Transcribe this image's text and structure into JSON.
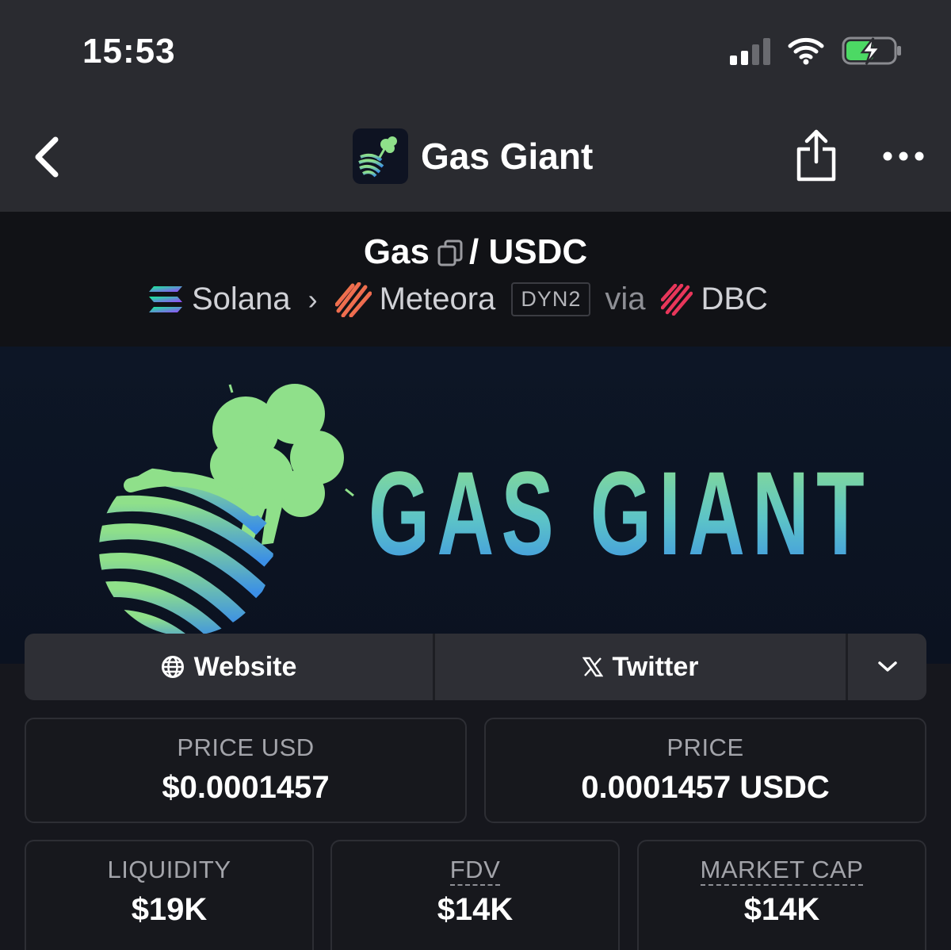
{
  "status_bar": {
    "time": "15:53",
    "signal_icon": "cellular-signal-icon",
    "wifi_icon": "wifi-icon",
    "battery_icon": "battery-charging-icon"
  },
  "nav": {
    "back_icon": "chevron-left-icon",
    "title": "Gas Giant",
    "share_icon": "share-icon",
    "more_icon": "ellipsis-icon"
  },
  "pair": {
    "base": "Gas",
    "separator": "/",
    "quote": "USDC",
    "chain": "Solana",
    "dex": "Meteora",
    "dex_badge": "DYN2",
    "via_label": "via",
    "launchpad": "DBC"
  },
  "banner": {
    "logo_text": "GAS GIANT"
  },
  "links": {
    "website_label": "Website",
    "twitter_label": "Twitter"
  },
  "stats": {
    "price_usd_label": "PRICE USD",
    "price_usd_value": "$0.0001457",
    "price_label": "PRICE",
    "price_value": "0.0001457 USDC",
    "liquidity_label": "LIQUIDITY",
    "liquidity_value": "$19K",
    "fdv_label": "FDV",
    "fdv_value": "$14K",
    "market_cap_label": "MARKET CAP",
    "market_cap_value": "$14K"
  },
  "colors": {
    "accent_green": "#8fe08a",
    "accent_blue": "#3b8fe6",
    "background": "#16171d"
  }
}
